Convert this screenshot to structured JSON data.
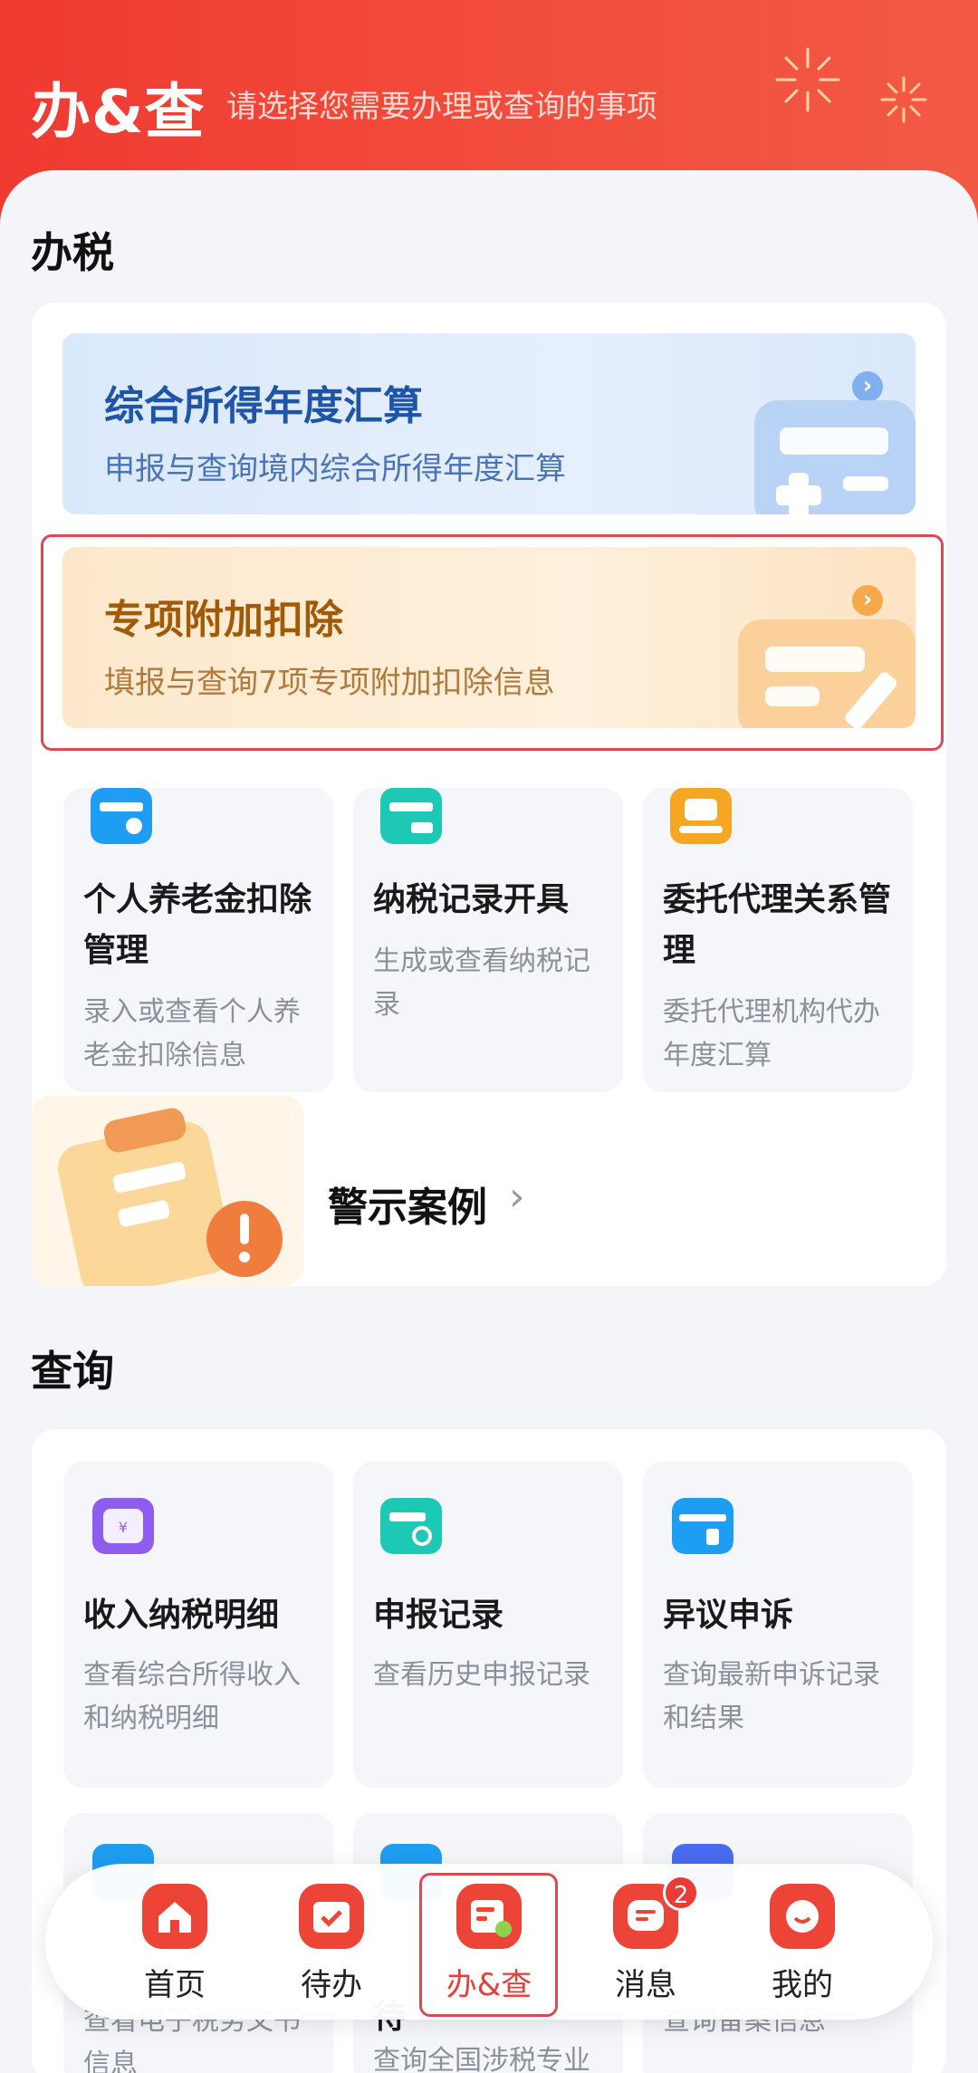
{
  "header": {
    "title": "办&查",
    "subtitle": "请选择您需要办理或查询的事项"
  },
  "tax_section": {
    "title": "办税",
    "banners": [
      {
        "title": "综合所得年度汇算",
        "desc": "申报与查询境内综合所得年度汇算",
        "icon": "calculator-icon"
      },
      {
        "title": "专项附加扣除",
        "desc": "填报与查询7项专项附加扣除信息",
        "icon": "form-pen-icon"
      }
    ],
    "tiles": [
      {
        "title": "个人养老金扣除管理",
        "desc": "录入或查看个人养老金扣除信息",
        "icon": "pension-card-icon",
        "color": "#1e9ef2"
      },
      {
        "title": "纳税记录开具",
        "desc": "生成或查看纳税记录",
        "icon": "tax-record-icon",
        "color": "#1dc8b4"
      },
      {
        "title": "委托代理关系管理",
        "desc": "委托代理机构代办年度汇算",
        "icon": "agent-hand-icon",
        "color": "#f5a623"
      }
    ],
    "warning": {
      "label": "警示案例",
      "icon": "warning-clipboard-icon"
    }
  },
  "query_section": {
    "title": "查询",
    "tiles": [
      {
        "title": "收入纳税明细",
        "desc": "查看综合所得收入和纳税明细",
        "icon": "income-wallet-icon",
        "color": "#8f5cf0"
      },
      {
        "title": "申报记录",
        "desc": "查看历史申报记录",
        "icon": "search-record-icon",
        "color": "#1dc8b4"
      },
      {
        "title": "异议申诉",
        "desc": "查询最新申诉记录和结果",
        "icon": "appeal-folder-icon",
        "color": "#1e9ef2"
      }
    ],
    "partial_tiles": [
      {
        "title": "",
        "desc": "查看电子税务文书信息"
      },
      {
        "title": "待",
        "desc": "查询全国涉税专业"
      },
      {
        "title": "",
        "desc": "查询备案信息"
      }
    ]
  },
  "bottom_nav": {
    "items": [
      {
        "label": "首页",
        "icon": "home-icon"
      },
      {
        "label": "待办",
        "icon": "todo-calendar-icon"
      },
      {
        "label": "办&查",
        "icon": "service-icon",
        "active": true
      },
      {
        "label": "消息",
        "icon": "message-icon",
        "badge": "2"
      },
      {
        "label": "我的",
        "icon": "profile-icon"
      }
    ]
  }
}
